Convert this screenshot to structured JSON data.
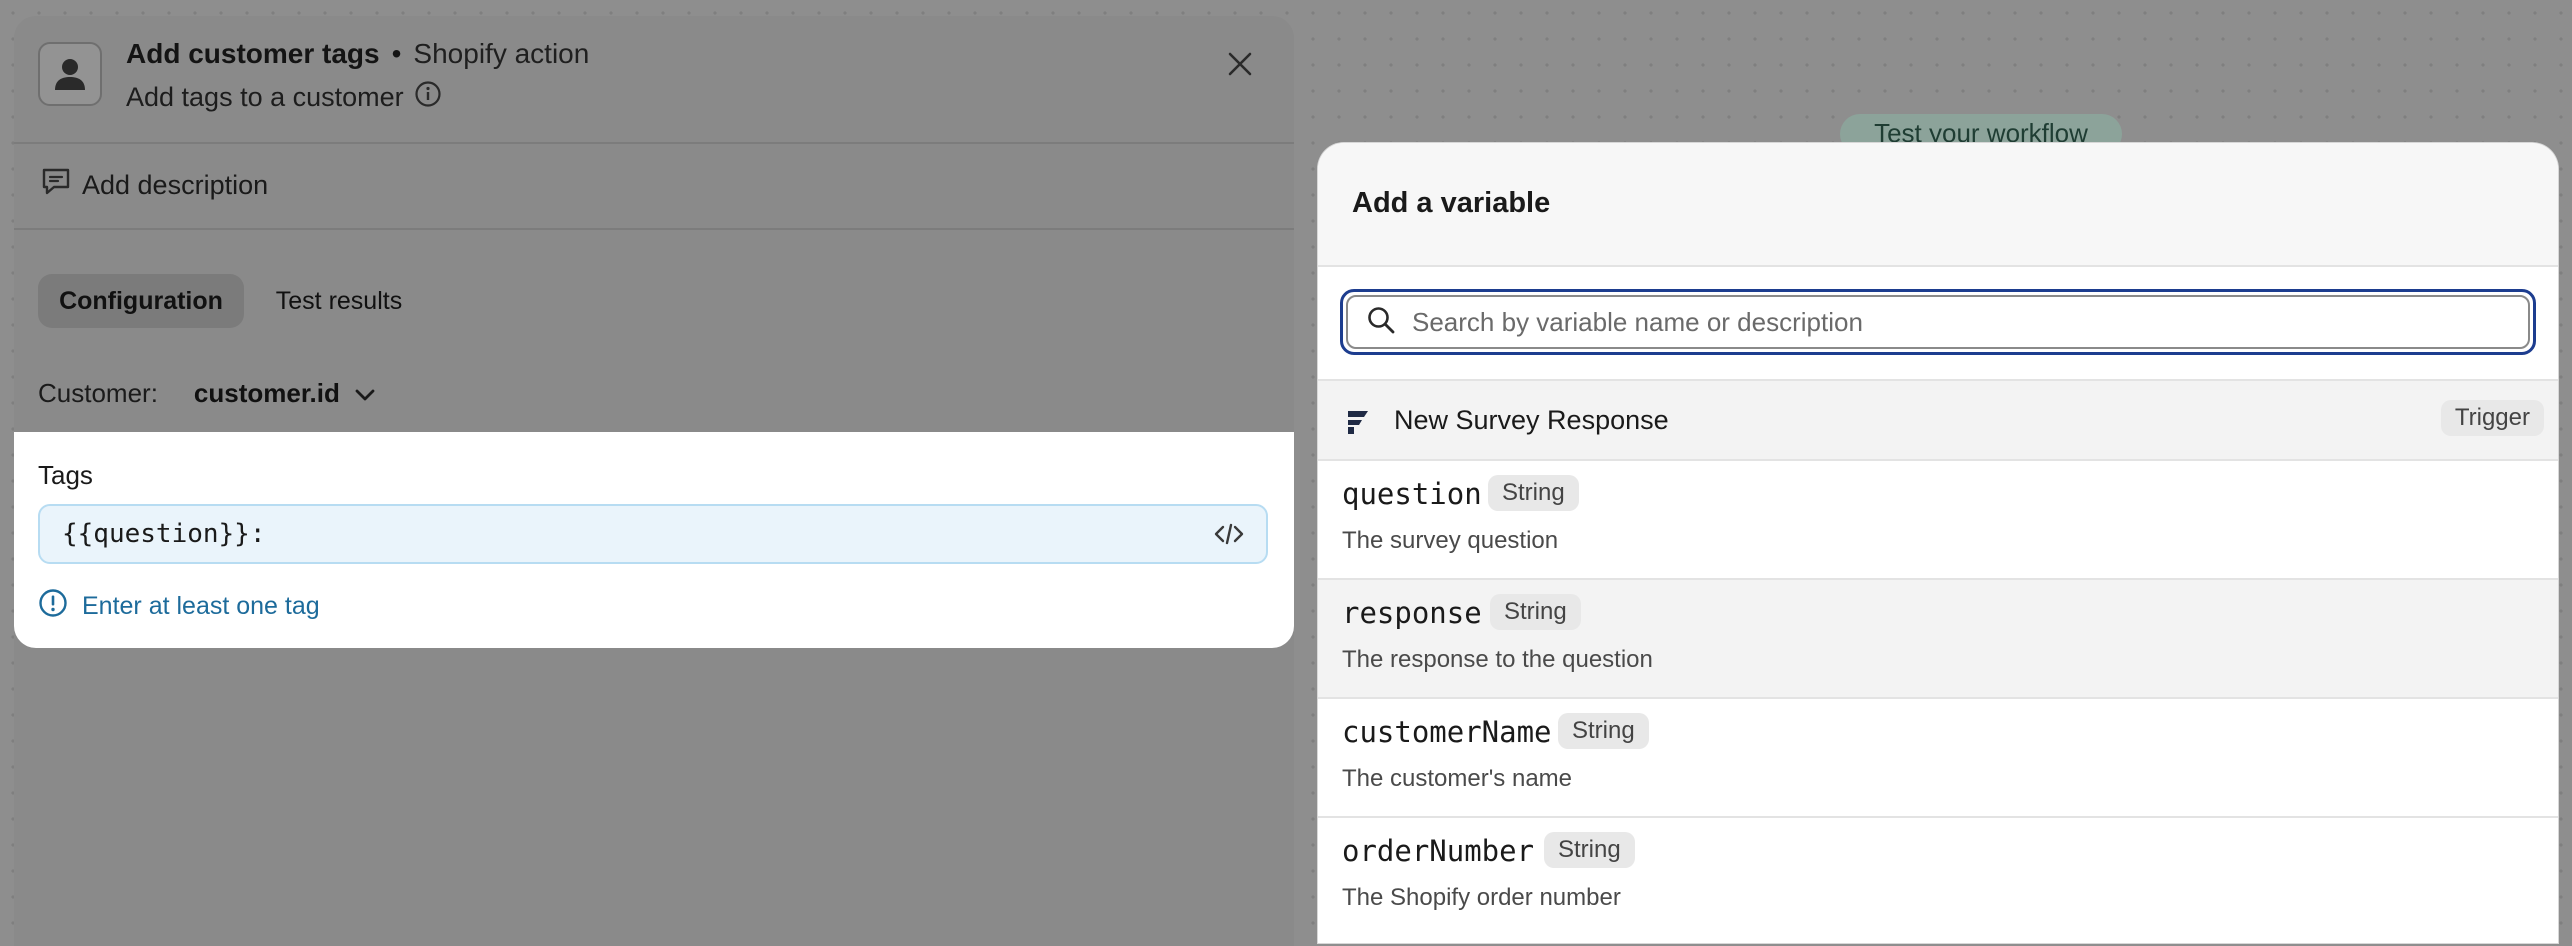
{
  "left_panel": {
    "title": "Add customer tags",
    "separator": "•",
    "action_type": "Shopify action",
    "subtitle": "Add tags to a customer",
    "add_description": "Add description",
    "tabs": [
      {
        "label": "Configuration",
        "active": true
      },
      {
        "label": "Test results",
        "active": false
      }
    ],
    "customer_label": "Customer:",
    "customer_value": "customer.id",
    "tags_label": "Tags",
    "tags_value": "{{question}}:",
    "tags_error": "Enter at least one tag"
  },
  "background": {
    "test_workflow": "Test your workflow"
  },
  "modal": {
    "title": "Add a variable",
    "search_placeholder": "Search by variable name or description",
    "group": {
      "name": "New Survey Response",
      "badge": "Trigger"
    },
    "variables": [
      {
        "name": "question",
        "type": "String",
        "description": "The survey question"
      },
      {
        "name": "response",
        "type": "String",
        "description": "The response to the question"
      },
      {
        "name": "customerName",
        "type": "String",
        "description": "The customer's name"
      },
      {
        "name": "orderNumber",
        "type": "String",
        "description": "The Shopify order number"
      }
    ]
  },
  "colors": {
    "accent_focus": "#1d3d8f",
    "error_text": "#1d6b9b",
    "input_bg": "#eaf4fb"
  }
}
